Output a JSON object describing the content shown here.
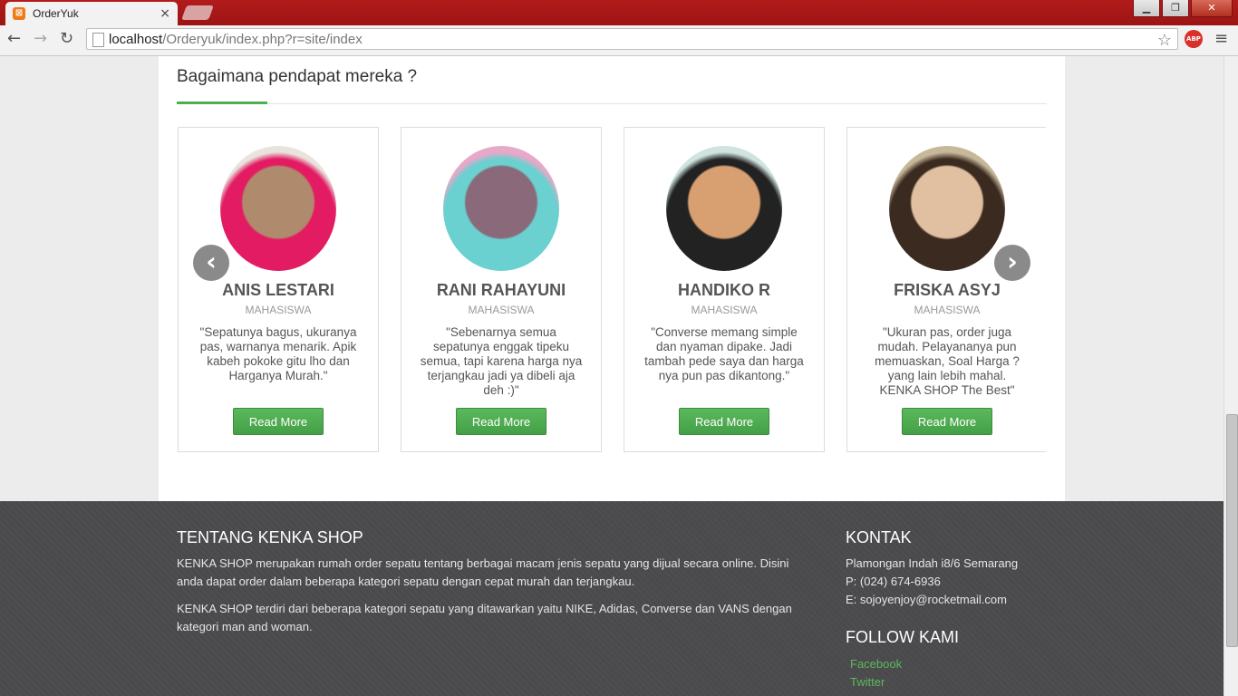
{
  "browser": {
    "tab_title": "OrderYuk",
    "tab_close": "×",
    "favicon_glyph": "⊠",
    "url_host": "localhost",
    "url_path": "/Orderyuk/index.php?r=site/index",
    "back_glyph": "←",
    "forward_glyph": "→",
    "reload_glyph": "↻",
    "star_glyph": "☆",
    "abp_label": "ABP",
    "menu_glyph": "≡",
    "win_min": "▁",
    "win_max": "❐",
    "win_close": "✕"
  },
  "testimonials": {
    "section_title": "Bagaimana pendapat mereka ?",
    "prev_glyph": "‹",
    "next_glyph": "›",
    "items": [
      {
        "name": "ANIS LESTARI",
        "role": "MAHASISWA",
        "quote": "\"Sepatunya bagus, ukuranya pas, warnanya menarik. Apik kabeh pokoke gitu lho dan Harganya Murah.\"",
        "button": "Read More",
        "avatar_colors": [
          "#e8e3dc",
          "#e31b63",
          "#b08a6c"
        ]
      },
      {
        "name": "RANI RAHAYUNI",
        "role": "MAHASISWA",
        "quote": "\"Sebenarnya semua sepatunya enggak tipeku semua, tapi karena harga nya terjangkau jadi ya dibeli aja deh :)\"",
        "button": "Read More",
        "avatar_colors": [
          "#e8a8c8",
          "#6ad0d0",
          "#8a6a7a"
        ]
      },
      {
        "name": "HANDIKO R",
        "role": "MAHASISWA",
        "quote": "\"Converse memang simple dan nyaman dipake. Jadi tambah pede saya dan harga nya pun pas dikantong.\"",
        "button": "Read More",
        "avatar_colors": [
          "#cfe4e0",
          "#222222",
          "#d8a070"
        ]
      },
      {
        "name": "FRISKA ASYJ",
        "role": "MAHASISWA",
        "quote": "\"Ukuran pas, order juga mudah. Pelayananya pun memuaskan, Soal Harga ? yang lain lebih mahal. KENKA SHOP The Best\"",
        "button": "Read More",
        "avatar_colors": [
          "#c8b89a",
          "#3a2a20",
          "#e0c0a0"
        ]
      }
    ]
  },
  "footer": {
    "about_title": "TENTANG KENKA SHOP",
    "about_p1": "KENKA SHOP merupakan rumah order sepatu tentang berbagai macam jenis sepatu yang dijual secara online. Disini anda dapat order dalam beberapa kategori sepatu dengan cepat murah dan terjangkau.",
    "about_p2": "KENKA SHOP terdiri dari beberapa kategori sepatu yang ditawarkan yaitu NIKE, Adidas, Converse dan VANS dengan kategori man and woman.",
    "contact_title": "KONTAK",
    "address": "Plamongan Indah i8/6 Semarang",
    "phone": "P: (024) 674-6936",
    "email": "E: sojoyenjoy@rocketmail.com",
    "follow_title": "FOLLOW KAMI",
    "links": [
      "Facebook",
      "Twitter"
    ]
  }
}
